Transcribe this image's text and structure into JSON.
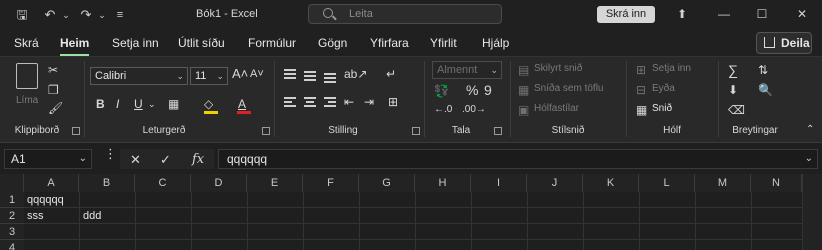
{
  "titlebar": {
    "title": "Bók1  -  Excel",
    "search_placeholder": "Leita",
    "signin_label": "Skrá inn"
  },
  "tabs": [
    {
      "label": "Skrá",
      "active": false
    },
    {
      "label": "Heim",
      "active": true
    },
    {
      "label": "Setja inn",
      "active": false
    },
    {
      "label": "Útlit síðu",
      "active": false
    },
    {
      "label": "Formúlur",
      "active": false
    },
    {
      "label": "Gögn",
      "active": false
    },
    {
      "label": "Yfirfara",
      "active": false
    },
    {
      "label": "Yfirlit",
      "active": false
    },
    {
      "label": "Hjálp",
      "active": false
    }
  ],
  "share_label": "Deila",
  "ribbon": {
    "clipboard": {
      "paste_label": "Líma",
      "group_label": "Klippiborð"
    },
    "font": {
      "font_name": "Calibri",
      "font_size": "11",
      "group_label": "Leturgerð"
    },
    "alignment": {
      "group_label": "Stilling"
    },
    "number": {
      "format": "Almennt",
      "group_label": "Tala"
    },
    "styles": {
      "conditional": "Skilyrt snið",
      "format_table": "Sníða sem töflu",
      "cell_styles": "Hólfastílar",
      "group_label": "Stílsnið"
    },
    "cells": {
      "insert": "Setja inn",
      "delete": "Eyða",
      "format": "Snið",
      "group_label": "Hólf"
    },
    "editing": {
      "group_label": "Breytingar"
    }
  },
  "formula_bar": {
    "name_box": "A1",
    "formula": "qqqqqq"
  },
  "grid": {
    "columns": [
      "A",
      "B",
      "C",
      "D",
      "E",
      "F",
      "G",
      "H",
      "I",
      "J",
      "K",
      "L",
      "M",
      "N"
    ],
    "rows": [
      "1",
      "2",
      "3",
      "4"
    ],
    "cells": {
      "A1": "qqqqqq",
      "A2": "sss",
      "B2": "ddd"
    }
  }
}
